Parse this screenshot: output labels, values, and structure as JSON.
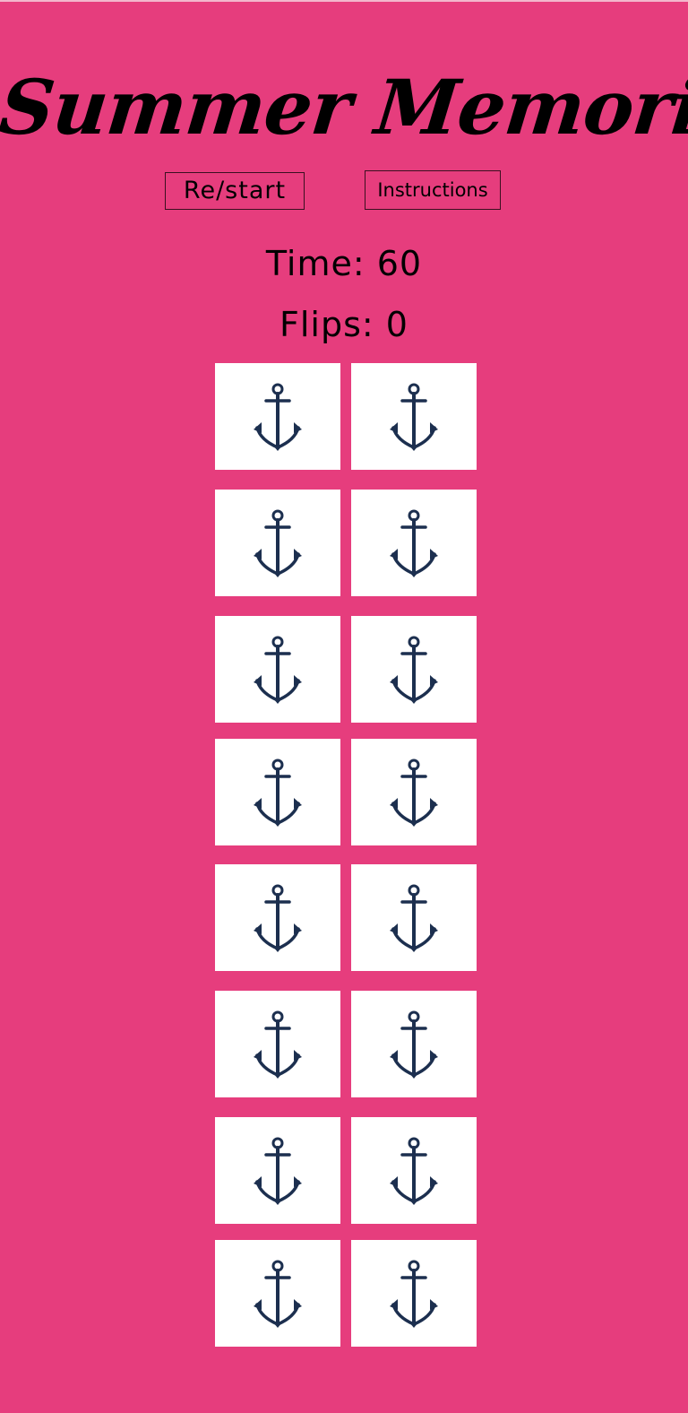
{
  "game": {
    "title": "Summer Memories",
    "background_color": "#e63d7d",
    "card_back_color": "#ffffff",
    "card_icon": "anchor-icon",
    "card_icon_color": "#1c2f4f"
  },
  "controls": {
    "restart_label": "Re/start",
    "instructions_label": "Instructions"
  },
  "stats": {
    "time_text": "Time: 60",
    "flips_text": "Flips: 0"
  },
  "board": {
    "rows": 8,
    "columns": 2,
    "card_count": 16,
    "face_down": true
  }
}
